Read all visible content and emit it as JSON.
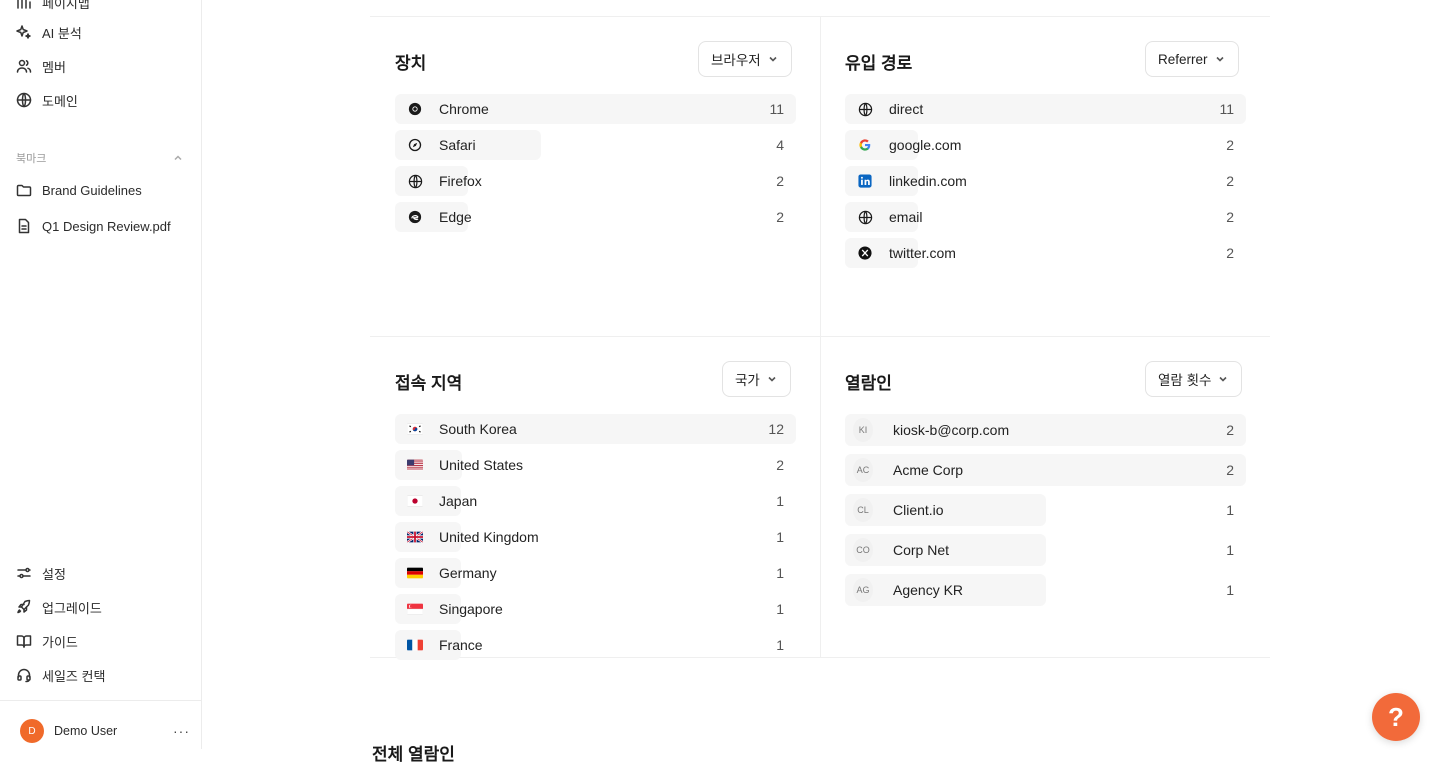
{
  "sidebar": {
    "top_items": [
      {
        "label": "페이지맵",
        "icon": "chart-icon"
      },
      {
        "label": "AI 분석",
        "icon": "sparkle-icon"
      },
      {
        "label": "멤버",
        "icon": "users-icon"
      },
      {
        "label": "도메인",
        "icon": "globe-icon"
      }
    ],
    "bookmarks_label": "북마크",
    "bookmarks": [
      {
        "label": "Brand Guidelines",
        "icon": "folder-icon"
      },
      {
        "label": "Q1 Design Review.pdf",
        "icon": "file-icon"
      }
    ],
    "bottom_items": [
      {
        "label": "설정",
        "icon": "sliders-icon"
      },
      {
        "label": "업그레이드",
        "icon": "rocket-icon"
      },
      {
        "label": "가이드",
        "icon": "book-icon"
      },
      {
        "label": "세일즈 컨택",
        "icon": "headset-icon"
      }
    ],
    "user": {
      "initial": "D",
      "name": "Demo User",
      "more": "···"
    }
  },
  "devices": {
    "title": "장치",
    "dropdown": "브라우저",
    "rows": [
      {
        "label": "Chrome",
        "count": "11",
        "fraction": 1.0,
        "icon": "chrome-icon"
      },
      {
        "label": "Safari",
        "count": "4",
        "fraction": 0.364,
        "icon": "safari-icon"
      },
      {
        "label": "Firefox",
        "count": "2",
        "fraction": 0.182,
        "icon": "globe-icon"
      },
      {
        "label": "Edge",
        "count": "2",
        "fraction": 0.182,
        "icon": "edge-icon"
      }
    ]
  },
  "referrers": {
    "title": "유입 경로",
    "dropdown": "Referrer",
    "rows": [
      {
        "label": "direct",
        "count": "11",
        "fraction": 1.0,
        "icon": "globe-icon"
      },
      {
        "label": "google.com",
        "count": "2",
        "fraction": 0.182,
        "icon": "google-icon"
      },
      {
        "label": "linkedin.com",
        "count": "2",
        "fraction": 0.182,
        "icon": "linkedin-icon"
      },
      {
        "label": "email",
        "count": "2",
        "fraction": 0.182,
        "icon": "globe-icon"
      },
      {
        "label": "twitter.com",
        "count": "2",
        "fraction": 0.182,
        "icon": "x-icon"
      }
    ]
  },
  "regions": {
    "title": "접속 지역",
    "dropdown": "국가",
    "rows": [
      {
        "label": "South Korea",
        "count": "12",
        "fraction": 1.0,
        "icon": "kr-flag-icon"
      },
      {
        "label": "United States",
        "count": "2",
        "fraction": 0.167,
        "icon": "us-flag-icon"
      },
      {
        "label": "Japan",
        "count": "1",
        "fraction": 0.083,
        "icon": "jp-flag-icon"
      },
      {
        "label": "United Kingdom",
        "count": "1",
        "fraction": 0.083,
        "icon": "uk-flag-icon"
      },
      {
        "label": "Germany",
        "count": "1",
        "fraction": 0.083,
        "icon": "de-flag-icon"
      },
      {
        "label": "Singapore",
        "count": "1",
        "fraction": 0.083,
        "icon": "sg-flag-icon"
      },
      {
        "label": "France",
        "count": "1",
        "fraction": 0.083,
        "icon": "fr-flag-icon"
      }
    ]
  },
  "viewers": {
    "title": "열람인",
    "dropdown": "열람 횟수",
    "rows": [
      {
        "initials": "KI",
        "label": "kiosk-b@corp.com",
        "count": "2",
        "fraction": 1.0
      },
      {
        "initials": "AC",
        "label": "Acme Corp",
        "count": "2",
        "fraction": 1.0
      },
      {
        "initials": "CL",
        "label": "Client.io",
        "count": "1",
        "fraction": 0.5
      },
      {
        "initials": "CO",
        "label": "Corp Net",
        "count": "1",
        "fraction": 0.5
      },
      {
        "initials": "AG",
        "label": "Agency KR",
        "count": "1",
        "fraction": 0.5
      }
    ]
  },
  "bottom_section_title": "전체 열람인",
  "help_button": "?",
  "colors": {
    "accent": "#f26a3a",
    "bar": "#f6f6f6"
  }
}
